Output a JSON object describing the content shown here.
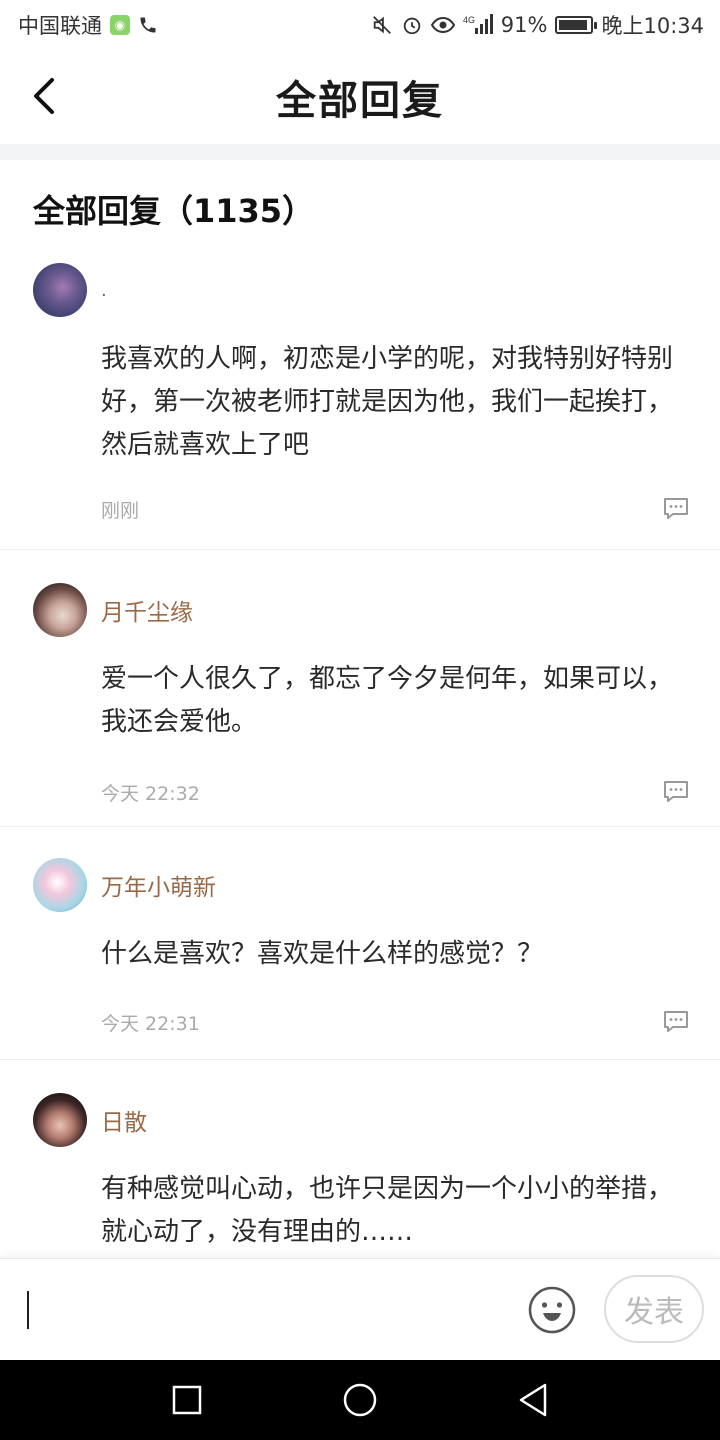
{
  "status_bar": {
    "carrier": "中国联通",
    "network": "4G",
    "battery_level": 0.91,
    "battery": "91%",
    "time": "晚上10:34"
  },
  "header": {
    "title": "全部回复",
    "back_icon": "chevron-left-icon"
  },
  "section": {
    "title": "全部回复（1135）"
  },
  "comments": [
    {
      "username": ".",
      "text": "我喜欢的人啊，初恋是小学的呢，对我特别好特别好，第一次被老师打就是因为他，我们一起挨打，然后就喜欢上了吧",
      "time": "刚刚",
      "avatar_colors": [
        "#3a3f6e",
        "#a27bb4"
      ]
    },
    {
      "username": "月千尘缘",
      "text": "爱一个人很久了，都忘了今夕是何年，如果可以，我还会爱他。",
      "time": "今天 22:32",
      "avatar_colors": [
        "#2b2121",
        "#e9d9cf"
      ]
    },
    {
      "username": "万年小萌新",
      "text": "什么是喜欢？喜欢是什么样的感觉？？",
      "time": "今天 22:31",
      "avatar_colors": [
        "#f2c7dc",
        "#a3d7e8"
      ]
    },
    {
      "username": "日散",
      "text": "有种感觉叫心动，也许只是因为一个小小的举措，就心动了，没有理由的……",
      "time": "",
      "avatar_colors": [
        "#1b1414",
        "#e8c3b9"
      ]
    }
  ],
  "input_bar": {
    "placeholder": "",
    "send_label": "发表",
    "emoji_icon": "emoji-icon"
  },
  "nav_bar": {
    "icons": [
      "recent-apps-icon",
      "home-icon",
      "back-triangle-icon"
    ]
  },
  "colors": {
    "username": "#9a6a48",
    "timestamp": "#aaaaaa",
    "separator_band": "#f3f4f6"
  }
}
